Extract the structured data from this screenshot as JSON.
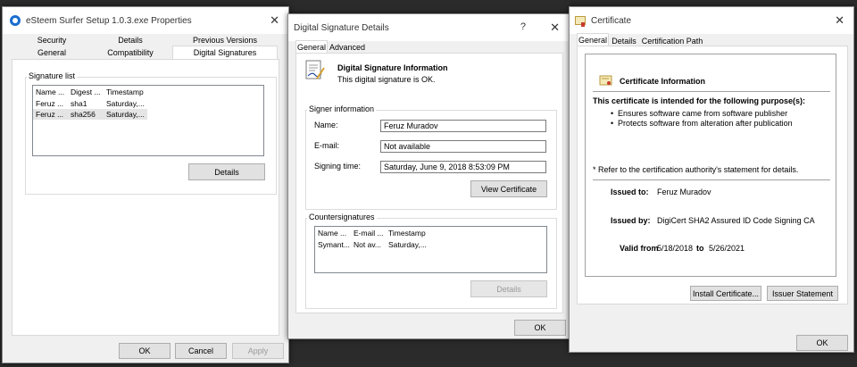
{
  "props": {
    "title": "eSteem Surfer Setup 1.0.3.exe Properties",
    "tabs_row1": [
      "Security",
      "Details",
      "Previous Versions"
    ],
    "tabs_row2": [
      "General",
      "Compatibility",
      "Digital Signatures"
    ],
    "signature_list_label": "Signature list",
    "columns": [
      "Name ...",
      "Digest ...",
      "Timestamp"
    ],
    "rows": [
      [
        "Feruz ...",
        "sha1",
        "Saturday,..."
      ],
      [
        "Feruz ...",
        "sha256",
        "Saturday,..."
      ]
    ],
    "details_button": "Details",
    "ok": "OK",
    "cancel": "Cancel",
    "apply": "Apply"
  },
  "details": {
    "title": "Digital Signature Details",
    "help": "?",
    "tabs": [
      "General",
      "Advanced"
    ],
    "info_heading": "Digital Signature Information",
    "info_text": "This digital signature is OK.",
    "signer_group": "Signer information",
    "name_label": "Name:",
    "name_value": "Feruz Muradov",
    "email_label": "E-mail:",
    "email_value": "Not available",
    "time_label": "Signing time:",
    "time_value": "Saturday, June 9, 2018 8:53:09 PM",
    "view_cert_button": "View Certificate",
    "counter_group": "Countersignatures",
    "counter_columns": [
      "Name ...",
      "E-mail ...",
      "Timestamp"
    ],
    "counter_rows": [
      [
        "Symant...",
        "Not av...",
        "Saturday,..."
      ]
    ],
    "counter_details_button": "Details",
    "ok": "OK"
  },
  "cert": {
    "title": "Certificate",
    "tabs": [
      "General",
      "Details",
      "Certification Path"
    ],
    "info_heading": "Certificate Information",
    "purpose_heading": "This certificate is intended for the following purpose(s):",
    "purposes": [
      "Ensures software came from software publisher",
      "Protects software from alteration after publication"
    ],
    "note": "* Refer to the certification authority's statement for details.",
    "issued_to_label": "Issued to:",
    "issued_to_value": "Feruz Muradov",
    "issued_by_label": "Issued by:",
    "issued_by_value": "DigiCert SHA2 Assured ID Code Signing CA",
    "valid_from_label": "Valid from",
    "valid_from_value": "5/18/2018",
    "valid_to_label": "to",
    "valid_to_value": "5/26/2021",
    "install_button": "Install Certificate...",
    "issuer_button": "Issuer Statement",
    "ok": "OK"
  }
}
